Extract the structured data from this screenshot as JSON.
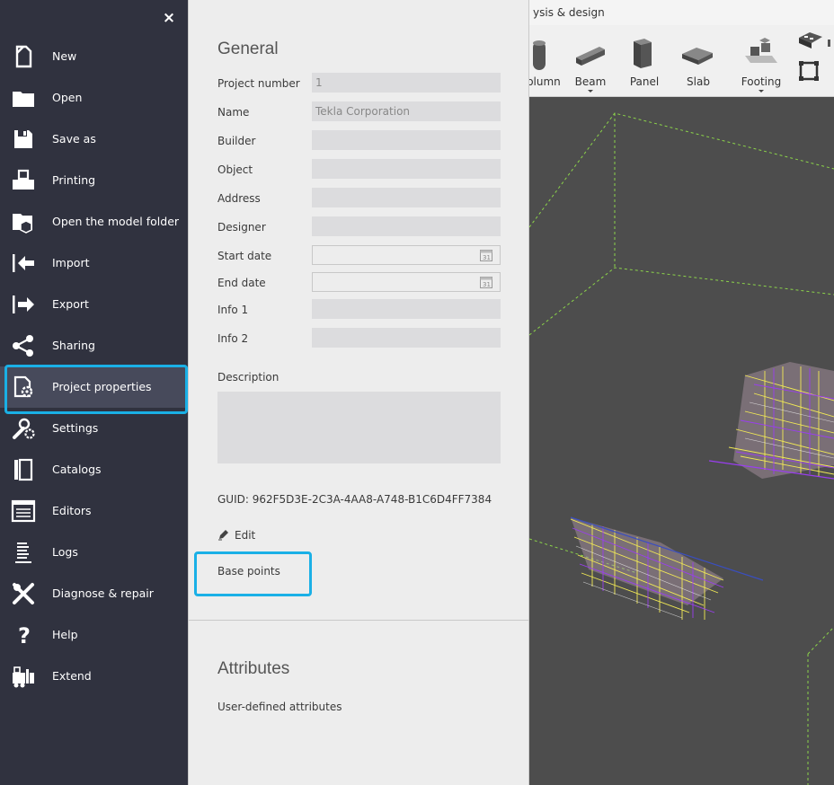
{
  "sidebar": {
    "close_label": "×",
    "items": [
      {
        "label": "New",
        "icon": "new-file-icon"
      },
      {
        "label": "Open",
        "icon": "folder-icon"
      },
      {
        "label": "Save as",
        "icon": "save-icon"
      },
      {
        "label": "Printing",
        "icon": "printer-icon"
      },
      {
        "label": "Open the model folder",
        "icon": "model-folder-icon"
      },
      {
        "label": "Import",
        "icon": "import-icon"
      },
      {
        "label": "Export",
        "icon": "export-icon"
      },
      {
        "label": "Sharing",
        "icon": "share-icon"
      },
      {
        "label": "Project properties",
        "icon": "project-properties-icon"
      },
      {
        "label": "Settings",
        "icon": "settings-icon"
      },
      {
        "label": "Catalogs",
        "icon": "catalog-icon"
      },
      {
        "label": "Editors",
        "icon": "editors-icon"
      },
      {
        "label": "Logs",
        "icon": "logs-icon"
      },
      {
        "label": "Diagnose & repair",
        "icon": "diagnose-repair-icon"
      },
      {
        "label": "Help",
        "icon": "help-icon"
      },
      {
        "label": "Extend",
        "icon": "extend-icon"
      }
    ],
    "selected": "Project properties"
  },
  "general": {
    "title": "General",
    "fields": {
      "project_number": {
        "label": "Project number",
        "value": "1"
      },
      "name": {
        "label": "Name",
        "value": "Tekla Corporation"
      },
      "builder": {
        "label": "Builder",
        "value": ""
      },
      "object": {
        "label": "Object",
        "value": ""
      },
      "address": {
        "label": "Address",
        "value": ""
      },
      "designer": {
        "label": "Designer",
        "value": ""
      },
      "start_date": {
        "label": "Start date",
        "value": ""
      },
      "end_date": {
        "label": "End date",
        "value": ""
      },
      "info1": {
        "label": "Info 1",
        "value": ""
      },
      "info2": {
        "label": "Info 2",
        "value": ""
      }
    },
    "description_label": "Description",
    "guid": "GUID: 962F5D3E-2C3A-4AA8-A748-B1C6D4FF7384",
    "edit_label": "Edit",
    "base_points_label": "Base points"
  },
  "attributes": {
    "title": "Attributes",
    "user_defined_label": "User-defined attributes"
  },
  "ribbon": {
    "tab_title": "ysis & design",
    "tools": [
      {
        "label": "olumn",
        "icon": "column-icon"
      },
      {
        "label": "Beam",
        "icon": "beam-icon"
      },
      {
        "label": "Panel",
        "icon": "panel-icon"
      },
      {
        "label": "Slab",
        "icon": "slab-icon"
      },
      {
        "label": "Footing",
        "icon": "footing-icon"
      }
    ]
  },
  "colors": {
    "sidebar_bg": "#30323f",
    "selected_bg": "#474a5b",
    "highlight": "#1ab0e6",
    "panel_bg": "#ededed",
    "viewport_bg": "#4d4d4d"
  }
}
